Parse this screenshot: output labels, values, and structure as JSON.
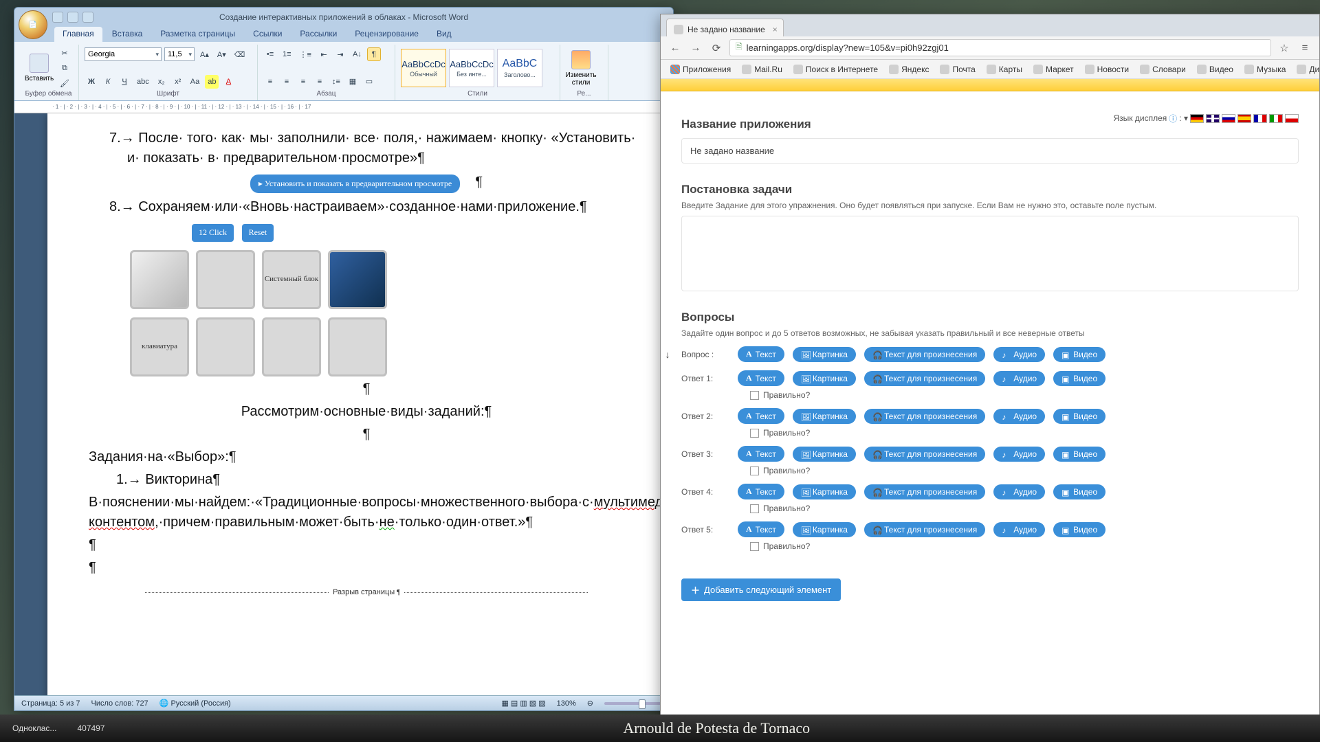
{
  "word": {
    "title": "Создание интерактивных приложений в облаках - Microsoft Word",
    "tabs": [
      "Главная",
      "Вставка",
      "Разметка страницы",
      "Ссылки",
      "Рассылки",
      "Рецензирование",
      "Вид"
    ],
    "groups": {
      "clipboard": "Буфер обмена",
      "font": "Шрифт",
      "paragraph": "Абзац",
      "styles": "Стили",
      "editing": "Ре..."
    },
    "paste": "Вставить",
    "font_name": "Georgia",
    "font_size": "11,5",
    "style_tiles": [
      {
        "sample": "AaBbCcDc",
        "name": "Обычный"
      },
      {
        "sample": "AaBbCcDc",
        "name": "Без инте..."
      },
      {
        "sample": "AaBbC",
        "name": "Заголово..."
      }
    ],
    "change_styles": "Изменить стили",
    "doc": {
      "line7": "7.→ После· того· как· мы· заполнили· все· поля,· нажимаем· кнопку· «Установить· и· показать· в· предварительном·просмотре»¶",
      "btn_preview": "▸ Установить и показать в предварительном просмотре",
      "line8": "8.→ Сохраняем·или·«Вновь·настраиваем»·созданное·нами·приложение.¶",
      "btn_12click": "12 Click",
      "btn_reset": "Reset",
      "tile_sys": "Системный блок",
      "tile_kbd": "клавиатура",
      "line_consider": "Рассмотрим·основные·виды·заданий:¶",
      "line_select": "Задания·на·«Выбор»:¶",
      "line_quiz": "1.→ Викторина¶",
      "line_expl": "В·пояснении·мы·найдем:·«Традиционные·вопросы·множественного·выбора·с·",
      "word_multi": "мультимедийным",
      "word_content": "контентом",
      "line_expl2": ",·причем·правильным·может·быть·",
      "word_ne": "не",
      "line_expl3": "·только·один·ответ.»¶",
      "pagebreak": "Разрыв страницы"
    },
    "status": {
      "page": "Страница: 5 из 7",
      "words": "Число слов: 727",
      "lang": "Русский (Россия)",
      "zoom": "130%"
    }
  },
  "chrome": {
    "tab_title": "Не задано название",
    "url": "learningapps.org/display?new=105&v=pi0h92zgj01",
    "bookmarks": [
      "Приложения",
      "Mail.Ru",
      "Поиск в Интернете",
      "Яндекс",
      "Почта",
      "Карты",
      "Маркет",
      "Новости",
      "Словари",
      "Видео",
      "Музыка",
      "Диск"
    ],
    "la": {
      "appname_h": "Название приложения",
      "langsel": "Язык дисплея",
      "appname_val": "Не задано название",
      "task_h": "Постановка задачи",
      "task_help": "Введите Задание для этого упражнения. Оно будет появляться при запуске. Если Вам не нужно это, оставьте поле пустым.",
      "questions_h": "Вопросы",
      "questions_help": "Задайте один вопрос и до 5 ответов возможных, не забывая указать правильный и все неверные ответы",
      "q_label": "Вопрос :",
      "a_labels": [
        "Ответ  1:",
        "Ответ  2:",
        "Ответ  3:",
        "Ответ  4:",
        "Ответ  5:"
      ],
      "pills": {
        "text": "Текст",
        "image": "Картинка",
        "tts": "Текст для произнесения",
        "audio": "Аудио",
        "video": "Видео"
      },
      "correct": "Правильно?",
      "add": "Добавить следующий элемент"
    }
  },
  "taskbar": {
    "left": "Одноклас...",
    "num": "407497",
    "caption": "Arnould de Potesta de Tornaco"
  }
}
